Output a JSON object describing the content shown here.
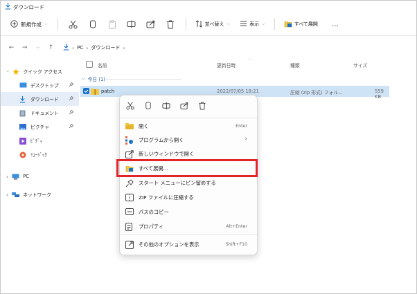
{
  "window": {
    "title": "ダウンロード"
  },
  "toolbar": {
    "new_label": "新規作成",
    "sort_label": "並べ替え",
    "view_label": "表示",
    "extract_label": "すべて展開",
    "more_label": "…"
  },
  "address": {
    "crumbs": [
      "PC",
      "ダウンロード"
    ]
  },
  "sidebar": {
    "items": [
      {
        "label": "クイック アクセス",
        "icon": "star-icon"
      },
      {
        "label": "デスクトップ",
        "icon": "desktop-icon"
      },
      {
        "label": "ダウンロード",
        "icon": "download-icon"
      },
      {
        "label": "ドキュメント",
        "icon": "document-icon"
      },
      {
        "label": "ピクチャ",
        "icon": "pictures-icon"
      },
      {
        "label": "ﾋﾞﾃﾞｨ",
        "icon": "video-icon"
      },
      {
        "label": "ﾐｭｰｼﾞｯｸ",
        "icon": "music-icon"
      },
      {
        "label": "PC",
        "icon": "pc-icon"
      },
      {
        "label": "ネットワーク",
        "icon": "network-icon"
      }
    ]
  },
  "columns": {
    "name": "名前",
    "date": "更新日時",
    "type": "種類",
    "size": "サイズ"
  },
  "group": {
    "label": "今日 (1)"
  },
  "file": {
    "name": "patch",
    "date": "2022/07/05 18:21",
    "type": "圧縮 (zip 形式) フォル...",
    "size": "559 KB"
  },
  "context_menu": {
    "top_icons": [
      "cut-icon",
      "copy-icon",
      "rename-icon",
      "share-icon",
      "delete-icon"
    ],
    "items": [
      {
        "label": "開く",
        "shortcut": "Enter",
        "icon": "open-icon"
      },
      {
        "label": "プログラムから開く",
        "shortcut": "›",
        "icon": "open-with-icon"
      },
      {
        "label": "新しいウィンドウで開く",
        "shortcut": "",
        "icon": "new-window-icon"
      },
      {
        "label": "すべて展開...",
        "shortcut": "",
        "icon": "extract-icon"
      },
      {
        "label": "スタート メニューにピン留めする",
        "shortcut": "",
        "icon": "pin-icon"
      },
      {
        "label": "ZIP ファイルに圧縮する",
        "shortcut": "",
        "icon": "zip-icon"
      },
      {
        "label": "パスのコピー",
        "shortcut": "",
        "icon": "copy-path-icon"
      },
      {
        "label": "プロパティ",
        "shortcut": "Alt+Enter",
        "icon": "properties-icon"
      },
      {
        "label": "その他のオプションを表示",
        "shortcut": "Shift+F10",
        "icon": "more-options-icon"
      }
    ]
  },
  "colors": {
    "accent": "#1a73c8",
    "selection": "#cfe3f7",
    "highlight_box": "#e3242b"
  }
}
